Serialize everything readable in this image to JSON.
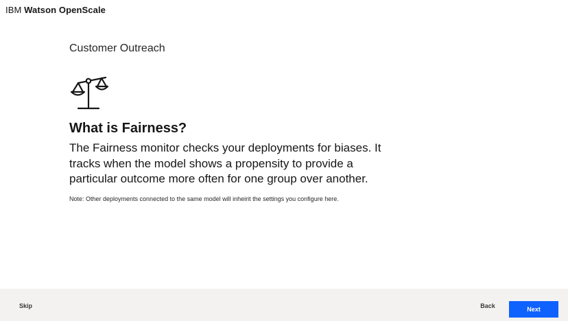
{
  "app": {
    "brand_prefix": "IBM",
    "brand_product": "Watson OpenScale"
  },
  "main": {
    "subtitle": "Customer Outreach",
    "icon": "balance-scale-icon",
    "heading": "What is Fairness?",
    "description": "The Fairness monitor checks your deployments for biases. It tracks when the model shows a propensity to provide a particular outcome more often for one group over another.",
    "note": "Note: Other deployments connected to the same model will inheirit the settings you configure here."
  },
  "footer": {
    "skip_label": "Skip",
    "back_label": "Back",
    "next_label": "Next"
  },
  "colors": {
    "accent": "#0f62fe",
    "footer_bg": "#f3f2f0",
    "text": "#161616"
  }
}
